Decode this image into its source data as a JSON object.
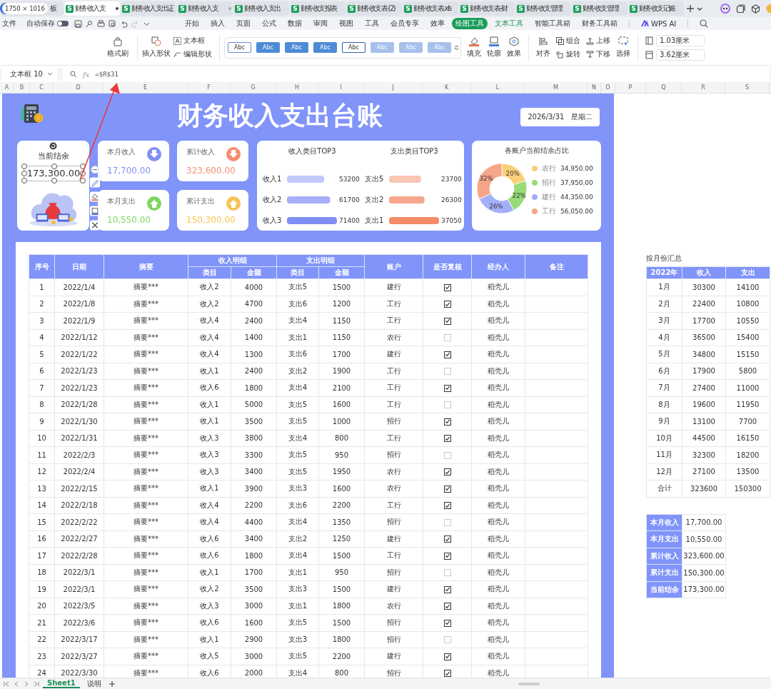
{
  "size_badge": "1750 × 1016",
  "browser_tabs": [
    {
      "title": "板",
      "selected": false,
      "modified": false
    },
    {
      "title": "财务收入支",
      "icon_letter": "S",
      "selected": true,
      "modified": true
    },
    {
      "title": "财务收入支出证",
      "icon_letter": "S",
      "selected": false,
      "modified": false
    },
    {
      "title": "财务收入支",
      "icon_letter": "S",
      "selected": false,
      "modified": true
    },
    {
      "title": "财务收入支出",
      "icon_letter": "S",
      "selected": false,
      "modified": false
    },
    {
      "title": "财务收支报表",
      "icon_letter": "S",
      "selected": false,
      "modified": false
    },
    {
      "title": "财务收支表 (2)",
      "icon_letter": "S",
      "selected": false,
      "modified": false
    },
    {
      "title": "财务收支表.xls",
      "icon_letter": "S",
      "selected": false,
      "modified": false
    },
    {
      "title": "财务收支表-财",
      "icon_letter": "S",
      "selected": false,
      "modified": false
    },
    {
      "title": "财务收支管理",
      "icon_letter": "S",
      "selected": false,
      "modified": false
    },
    {
      "title": "财务收支管理",
      "icon_letter": "S",
      "selected": false,
      "modified": false
    },
    {
      "title": "财务收支记账",
      "icon_letter": "S",
      "selected": false,
      "modified": false
    }
  ],
  "menu": {
    "file": "文件",
    "autosave": {
      "label": "自动保存",
      "on": false
    },
    "items": [
      {
        "label": "开始",
        "kind": "tab",
        "selected": false
      },
      {
        "label": "插入",
        "kind": "tab",
        "selected": false
      },
      {
        "label": "页面",
        "kind": "tab",
        "selected": false
      },
      {
        "label": "公式",
        "kind": "tab",
        "selected": false
      },
      {
        "label": "数据",
        "kind": "tab",
        "selected": false
      },
      {
        "label": "审阅",
        "kind": "tab",
        "selected": false
      },
      {
        "label": "视图",
        "kind": "tab",
        "selected": false
      },
      {
        "label": "工具",
        "kind": "tab",
        "selected": false
      },
      {
        "label": "会员专享",
        "kind": "tab",
        "selected": false
      },
      {
        "label": "效率",
        "kind": "tab",
        "selected": false
      },
      {
        "label": "绘图工具",
        "kind": "context",
        "selected": true
      },
      {
        "label": "文本工具",
        "kind": "context",
        "selected": false
      },
      {
        "label": "智能工具箱",
        "kind": "tab",
        "selected": false
      },
      {
        "label": "财务工具箱",
        "kind": "tab",
        "selected": false
      }
    ],
    "ai": "WPS AI"
  },
  "ribbon": {
    "format_painter": "格式刷",
    "insert_shape": "插入形状",
    "text_box": "文本框",
    "edit_shape": "编辑形状",
    "styles": [
      {
        "label": "Abc",
        "kind": "outline"
      },
      {
        "label": "Abc",
        "kind": "solid"
      },
      {
        "label": "Abc",
        "kind": "solid"
      },
      {
        "label": "Abc",
        "kind": "solid"
      },
      {
        "label": "Abc",
        "kind": "dark-outline"
      },
      {
        "label": "Abc",
        "kind": "light"
      },
      {
        "label": "Abc",
        "kind": "light"
      },
      {
        "label": "Abc",
        "kind": "light"
      }
    ],
    "fill": "填充",
    "outline": "轮廓",
    "effect": "效果",
    "align": "对齐",
    "group": "组合",
    "rotate": "旋转",
    "bring_forward": "上移",
    "send_backward": "下移",
    "select": "选择",
    "height": "1.03厘米",
    "width": "3.62厘米"
  },
  "formula_bar": {
    "name_box": "文本框 10",
    "fx": "fx",
    "formula": "=$R$31"
  },
  "column_headers": [
    "A",
    "B",
    "C",
    "D",
    "E",
    "F",
    "G",
    "H",
    "I",
    "J",
    "K",
    "L",
    "M",
    "N",
    "O",
    "P",
    "Q",
    "R",
    "S"
  ],
  "dashboard": {
    "title": "财务收入支出台账",
    "date": "2026/3/31   星期二",
    "balance": {
      "label": "当前结余",
      "value": "173,300.00"
    },
    "stats": [
      {
        "label": "本月收入",
        "value": "17,700.00",
        "color": "#8190f6",
        "kind": "down"
      },
      {
        "label": "累计收入",
        "value": "323,600.00",
        "color": "#f58f6f",
        "kind": "down"
      },
      {
        "label": "本月支出",
        "value": "10,550.00",
        "color": "#7fd562",
        "kind": "up"
      },
      {
        "label": "累计支出",
        "value": "150,300.00",
        "color": "#f8c255",
        "kind": "up"
      }
    ],
    "income_top3": {
      "chart_data": {
        "type": "bar",
        "orientation": "horizontal",
        "title": "收入类目TOP3",
        "categories": [
          "收入1",
          "收入2",
          "收入3"
        ],
        "series": [
          {
            "values": [
              53200,
              61700,
              71400
            ]
          }
        ],
        "data_labels": true
      },
      "bars": [
        {
          "color": "#c3c9fb"
        },
        {
          "color": "#a5b0f8"
        },
        {
          "color": "#7f8ef5"
        }
      ]
    },
    "expense_top3": {
      "chart_data": {
        "type": "bar",
        "orientation": "horizontal",
        "title": "支出类目TOP3",
        "categories": [
          "支出5",
          "支出2",
          "支出1"
        ],
        "series": [
          {
            "values": [
              23700,
              26300,
              37050
            ]
          }
        ],
        "data_labels": true
      },
      "bars": [
        {
          "color": "#f9c5b4"
        },
        {
          "color": "#f7a78d"
        },
        {
          "color": "#f58b68"
        }
      ]
    },
    "account_share": {
      "chart_data": {
        "type": "donut",
        "title": "各账户当前结余占比",
        "categories": [
          "农行",
          "招行",
          "建行",
          "工行"
        ],
        "series": [
          {
            "values": [
              20,
              22,
              26,
              32
            ]
          }
        ]
      },
      "slices": [
        {
          "color": "#fbcf78",
          "percent_label": "20%",
          "amount": "34,950.00"
        },
        {
          "color": "#98dc7a",
          "percent_label": "22%",
          "amount": "37,950.00"
        },
        {
          "color": "#a4affa",
          "percent_label": "26%",
          "amount": "44,350.00"
        },
        {
          "color": "#f7a588",
          "percent_label": "32%",
          "amount": "56,050.00"
        }
      ]
    }
  },
  "ledger": {
    "header": [
      {
        "label": "序号"
      },
      {
        "label": "日期"
      },
      {
        "label": "摘要"
      },
      {
        "label": "收入明细",
        "sub": [
          "类目",
          "金额"
        ]
      },
      {
        "label": "支出明细",
        "sub": [
          "类目",
          "金额"
        ]
      },
      {
        "label": "账户"
      },
      {
        "label": "是否复核"
      },
      {
        "label": "经办人"
      },
      {
        "label": "备注"
      }
    ],
    "rows": [
      {
        "cells": [
          "1",
          "2022/1/4",
          "摘要***",
          "收入2",
          "4000",
          "支出5",
          "1500",
          "建行"
        ],
        "reviewed": true,
        "handler": "稻壳儿"
      },
      {
        "cells": [
          "2",
          "2022/1/8",
          "摘要***",
          "收入2",
          "4700",
          "支出6",
          "1200",
          "工行"
        ],
        "reviewed": true,
        "handler": "稻壳儿"
      },
      {
        "cells": [
          "3",
          "2022/1/9",
          "摘要***",
          "收入4",
          "2400",
          "支出4",
          "1150",
          "工行"
        ],
        "reviewed": true,
        "handler": "稻壳儿"
      },
      {
        "cells": [
          "4",
          "2022/1/12",
          "摘要***",
          "收入4",
          "1400",
          "支出1",
          "1150",
          "农行"
        ],
        "reviewed": false,
        "handler": "稻壳儿"
      },
      {
        "cells": [
          "5",
          "2022/1/22",
          "摘要***",
          "收入4",
          "1300",
          "支出6",
          "1700",
          "建行"
        ],
        "reviewed": true,
        "handler": "稻壳儿"
      },
      {
        "cells": [
          "6",
          "2022/1/23",
          "摘要***",
          "收入1",
          "2400",
          "支出2",
          "1900",
          "工行"
        ],
        "reviewed": false,
        "handler": "稻壳儿"
      },
      {
        "cells": [
          "7",
          "2022/1/23",
          "摘要***",
          "收入6",
          "1800",
          "支出4",
          "2100",
          "工行"
        ],
        "reviewed": true,
        "handler": "稻壳儿"
      },
      {
        "cells": [
          "8",
          "2022/1/28",
          "摘要***",
          "收入1",
          "5000",
          "支出5",
          "1600",
          "工行"
        ],
        "reviewed": false,
        "handler": "稻壳儿"
      },
      {
        "cells": [
          "9",
          "2022/1/30",
          "摘要***",
          "收入1",
          "3500",
          "支出5",
          "1000",
          "招行"
        ],
        "reviewed": true,
        "handler": "稻壳儿"
      },
      {
        "cells": [
          "10",
          "2022/1/31",
          "摘要***",
          "收入3",
          "3800",
          "支出4",
          "800",
          "工行"
        ],
        "reviewed": true,
        "handler": "稻壳儿"
      },
      {
        "cells": [
          "11",
          "2022/2/3",
          "摘要***",
          "收入3",
          "3300",
          "支出5",
          "950",
          "招行"
        ],
        "reviewed": false,
        "handler": "稻壳儿"
      },
      {
        "cells": [
          "12",
          "2022/2/4",
          "摘要***",
          "收入3",
          "3400",
          "支出5",
          "1950",
          "农行"
        ],
        "reviewed": true,
        "handler": "稻壳儿"
      },
      {
        "cells": [
          "13",
          "2022/2/15",
          "摘要***",
          "收入1",
          "3900",
          "支出3",
          "1600",
          "农行"
        ],
        "reviewed": true,
        "handler": "稻壳儿"
      },
      {
        "cells": [
          "14",
          "2022/2/18",
          "摘要***",
          "收入4",
          "2200",
          "支出6",
          "2200",
          "工行"
        ],
        "reviewed": true,
        "handler": "稻壳儿"
      },
      {
        "cells": [
          "15",
          "2022/2/22",
          "摘要***",
          "收入4",
          "4400",
          "支出4",
          "1350",
          "招行"
        ],
        "reviewed": false,
        "handler": "稻壳儿"
      },
      {
        "cells": [
          "16",
          "2022/2/27",
          "摘要***",
          "收入6",
          "3400",
          "支出2",
          "1250",
          "建行"
        ],
        "reviewed": true,
        "handler": "稻壳儿"
      },
      {
        "cells": [
          "17",
          "2022/2/28",
          "摘要***",
          "收入6",
          "1800",
          "支出4",
          "1500",
          "工行"
        ],
        "reviewed": true,
        "handler": "稻壳儿"
      },
      {
        "cells": [
          "18",
          "2022/3/1",
          "摘要***",
          "收入1",
          "1700",
          "支出1",
          "950",
          "招行"
        ],
        "reviewed": false,
        "handler": "稻壳儿"
      },
      {
        "cells": [
          "19",
          "2022/3/1",
          "摘要***",
          "收入2",
          "3500",
          "支出3",
          "1500",
          "建行"
        ],
        "reviewed": true,
        "handler": "稻壳儿"
      },
      {
        "cells": [
          "20",
          "2022/3/5",
          "摘要***",
          "收入3",
          "3000",
          "支出1",
          "1800",
          "农行"
        ],
        "reviewed": true,
        "handler": "稻壳儿"
      },
      {
        "cells": [
          "21",
          "2022/3/6",
          "摘要***",
          "收入6",
          "1600",
          "支出5",
          "1500",
          "招行"
        ],
        "reviewed": true,
        "handler": "稻壳儿"
      },
      {
        "cells": [
          "22",
          "2022/3/17",
          "摘要***",
          "收入1",
          "2900",
          "支出3",
          "1800",
          "招行"
        ],
        "reviewed": false,
        "handler": "稻壳儿"
      },
      {
        "cells": [
          "23",
          "2022/3/27",
          "摘要***",
          "收入5",
          "3000",
          "支出5",
          "2200",
          "建行"
        ],
        "reviewed": true,
        "handler": "稻壳儿"
      },
      {
        "cells": [
          "24",
          "2022/3/30",
          "摘要***",
          "收入6",
          "2000",
          "支出4",
          "800",
          "招行"
        ],
        "reviewed": true,
        "handler": "稻壳儿"
      }
    ]
  },
  "monthly_summary": {
    "title": "按月份汇总",
    "columns": [
      "2022年",
      "收入",
      "支出"
    ],
    "rows": [
      [
        "1月",
        "30300",
        "14100"
      ],
      [
        "2月",
        "22400",
        "10800"
      ],
      [
        "3月",
        "17700",
        "10550"
      ],
      [
        "4月",
        "36500",
        "15400"
      ],
      [
        "5月",
        "34800",
        "15150"
      ],
      [
        "6月",
        "17900",
        "5800"
      ],
      [
        "7月",
        "27400",
        "11000"
      ],
      [
        "8月",
        "19600",
        "11950"
      ],
      [
        "9月",
        "13100",
        "7700"
      ],
      [
        "10月",
        "44500",
        "16150"
      ],
      [
        "11月",
        "32300",
        "18200"
      ],
      [
        "12月",
        "27100",
        "13500"
      ],
      [
        "合计",
        "323600",
        "150300"
      ]
    ]
  },
  "summary": [
    {
      "label": "本月收入",
      "value": "17,700.00"
    },
    {
      "label": "本月支出",
      "value": "10,550.00"
    },
    {
      "label": "累计收入",
      "value": "323,600.00"
    },
    {
      "label": "累计支出",
      "value": "150,300.00"
    },
    {
      "label": "当前结余",
      "value": "173,300.00"
    }
  ],
  "sheet_tabs": [
    {
      "label": "Sheet1",
      "selected": true
    },
    {
      "label": "说明",
      "selected": false
    }
  ]
}
